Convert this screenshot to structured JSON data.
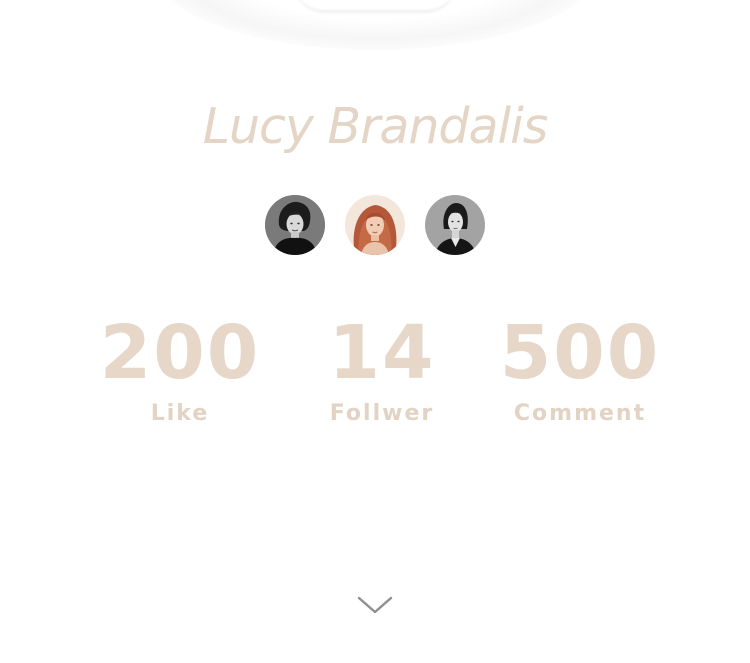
{
  "profile": {
    "name": "Lucy Brandalis",
    "avatars": [
      {
        "icon": "woman-dark-hair-bw-avatar"
      },
      {
        "icon": "woman-red-hair-avatar"
      },
      {
        "icon": "woman-dark-hair-grey-avatar"
      }
    ]
  },
  "stats": [
    {
      "value": "200",
      "label": "Like"
    },
    {
      "value": "14",
      "label": "Follwer"
    },
    {
      "value": "500",
      "label": "Comment"
    }
  ],
  "colors": {
    "accent": "#e4d5c6",
    "chevron": "#8f8f8f",
    "background": "#ffffff"
  },
  "scroll": {
    "icon": "chevron-down-icon"
  }
}
